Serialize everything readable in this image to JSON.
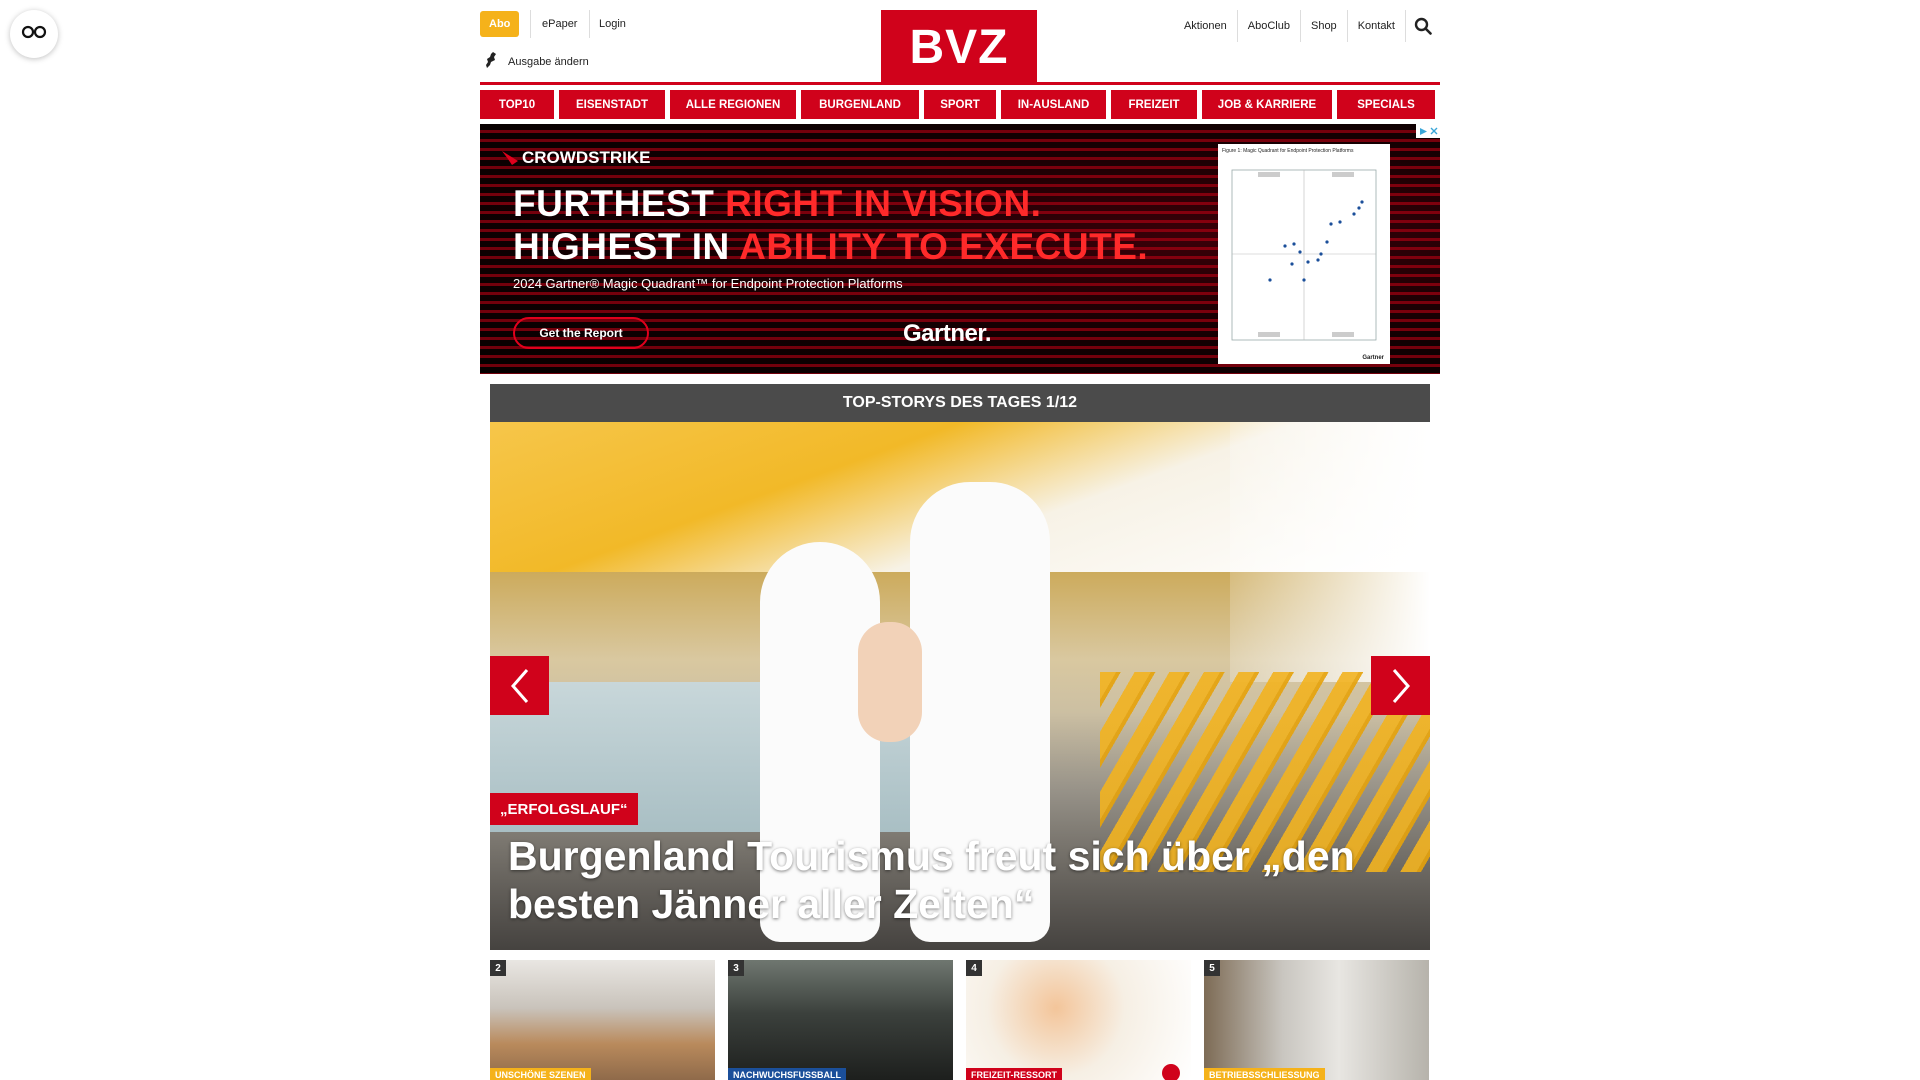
{
  "reader": {
    "icon": "glasses-icon"
  },
  "header": {
    "abo_label": "Abo",
    "epaper_label": "ePaper",
    "login_label": "Login",
    "edition_label": "Ausgabe ändern",
    "logo_text": "BVZ",
    "right_links": [
      "Aktionen",
      "AboClub",
      "Shop",
      "Kontakt"
    ],
    "search_icon": "search-icon",
    "colors": {
      "brand": "#d0021b",
      "abo": "#f5b21a"
    }
  },
  "nav": {
    "items": [
      "TOP10",
      "EISENSTADT",
      "ALLE REGIONEN",
      "BURGENLAND",
      "SPORT",
      "IN-AUSLAND",
      "FREIZEIT",
      "JOB & KARRIERE",
      "SPECIALS"
    ]
  },
  "ad": {
    "brand": "CROWDSTRIKE",
    "line1_white": "FURTHEST ",
    "line1_red": "RIGHT IN VISION.",
    "line2_white": "HIGHEST IN ",
    "line2_red": "ABILITY TO EXECUTE.",
    "subline": "2024 Gartner® Magic Quadrant™ for Endpoint Protection Platforms",
    "cta": "Get the Report",
    "gartner": "Gartner.",
    "panel_caption": "Figure 1: Magic Quadrant for Endpoint Protection Platforms",
    "panel_footer": "Gartner"
  },
  "top_stories": {
    "heading": "TOP-STORYS DES TAGES 1/12",
    "hero": {
      "tag": "„ERFOLGSLAUF“",
      "title": "Burgenland Tourismus freut sich über „den besten Jänner aller Zeiten“"
    },
    "thumbnails": [
      {
        "num": "2",
        "label": "UNSCHÖNE SZENEN",
        "label_color": "#f5b21a"
      },
      {
        "num": "3",
        "label": "NACHWUCHSFUSSBALL",
        "label_color": "#1b4f9a"
      },
      {
        "num": "4",
        "label": "FREIZEIT-RESSORT",
        "label_color": "#d0021b"
      },
      {
        "num": "5",
        "label": "BETRIEBSSCHLIESSUNG",
        "label_color": "#f5b21a"
      }
    ]
  }
}
